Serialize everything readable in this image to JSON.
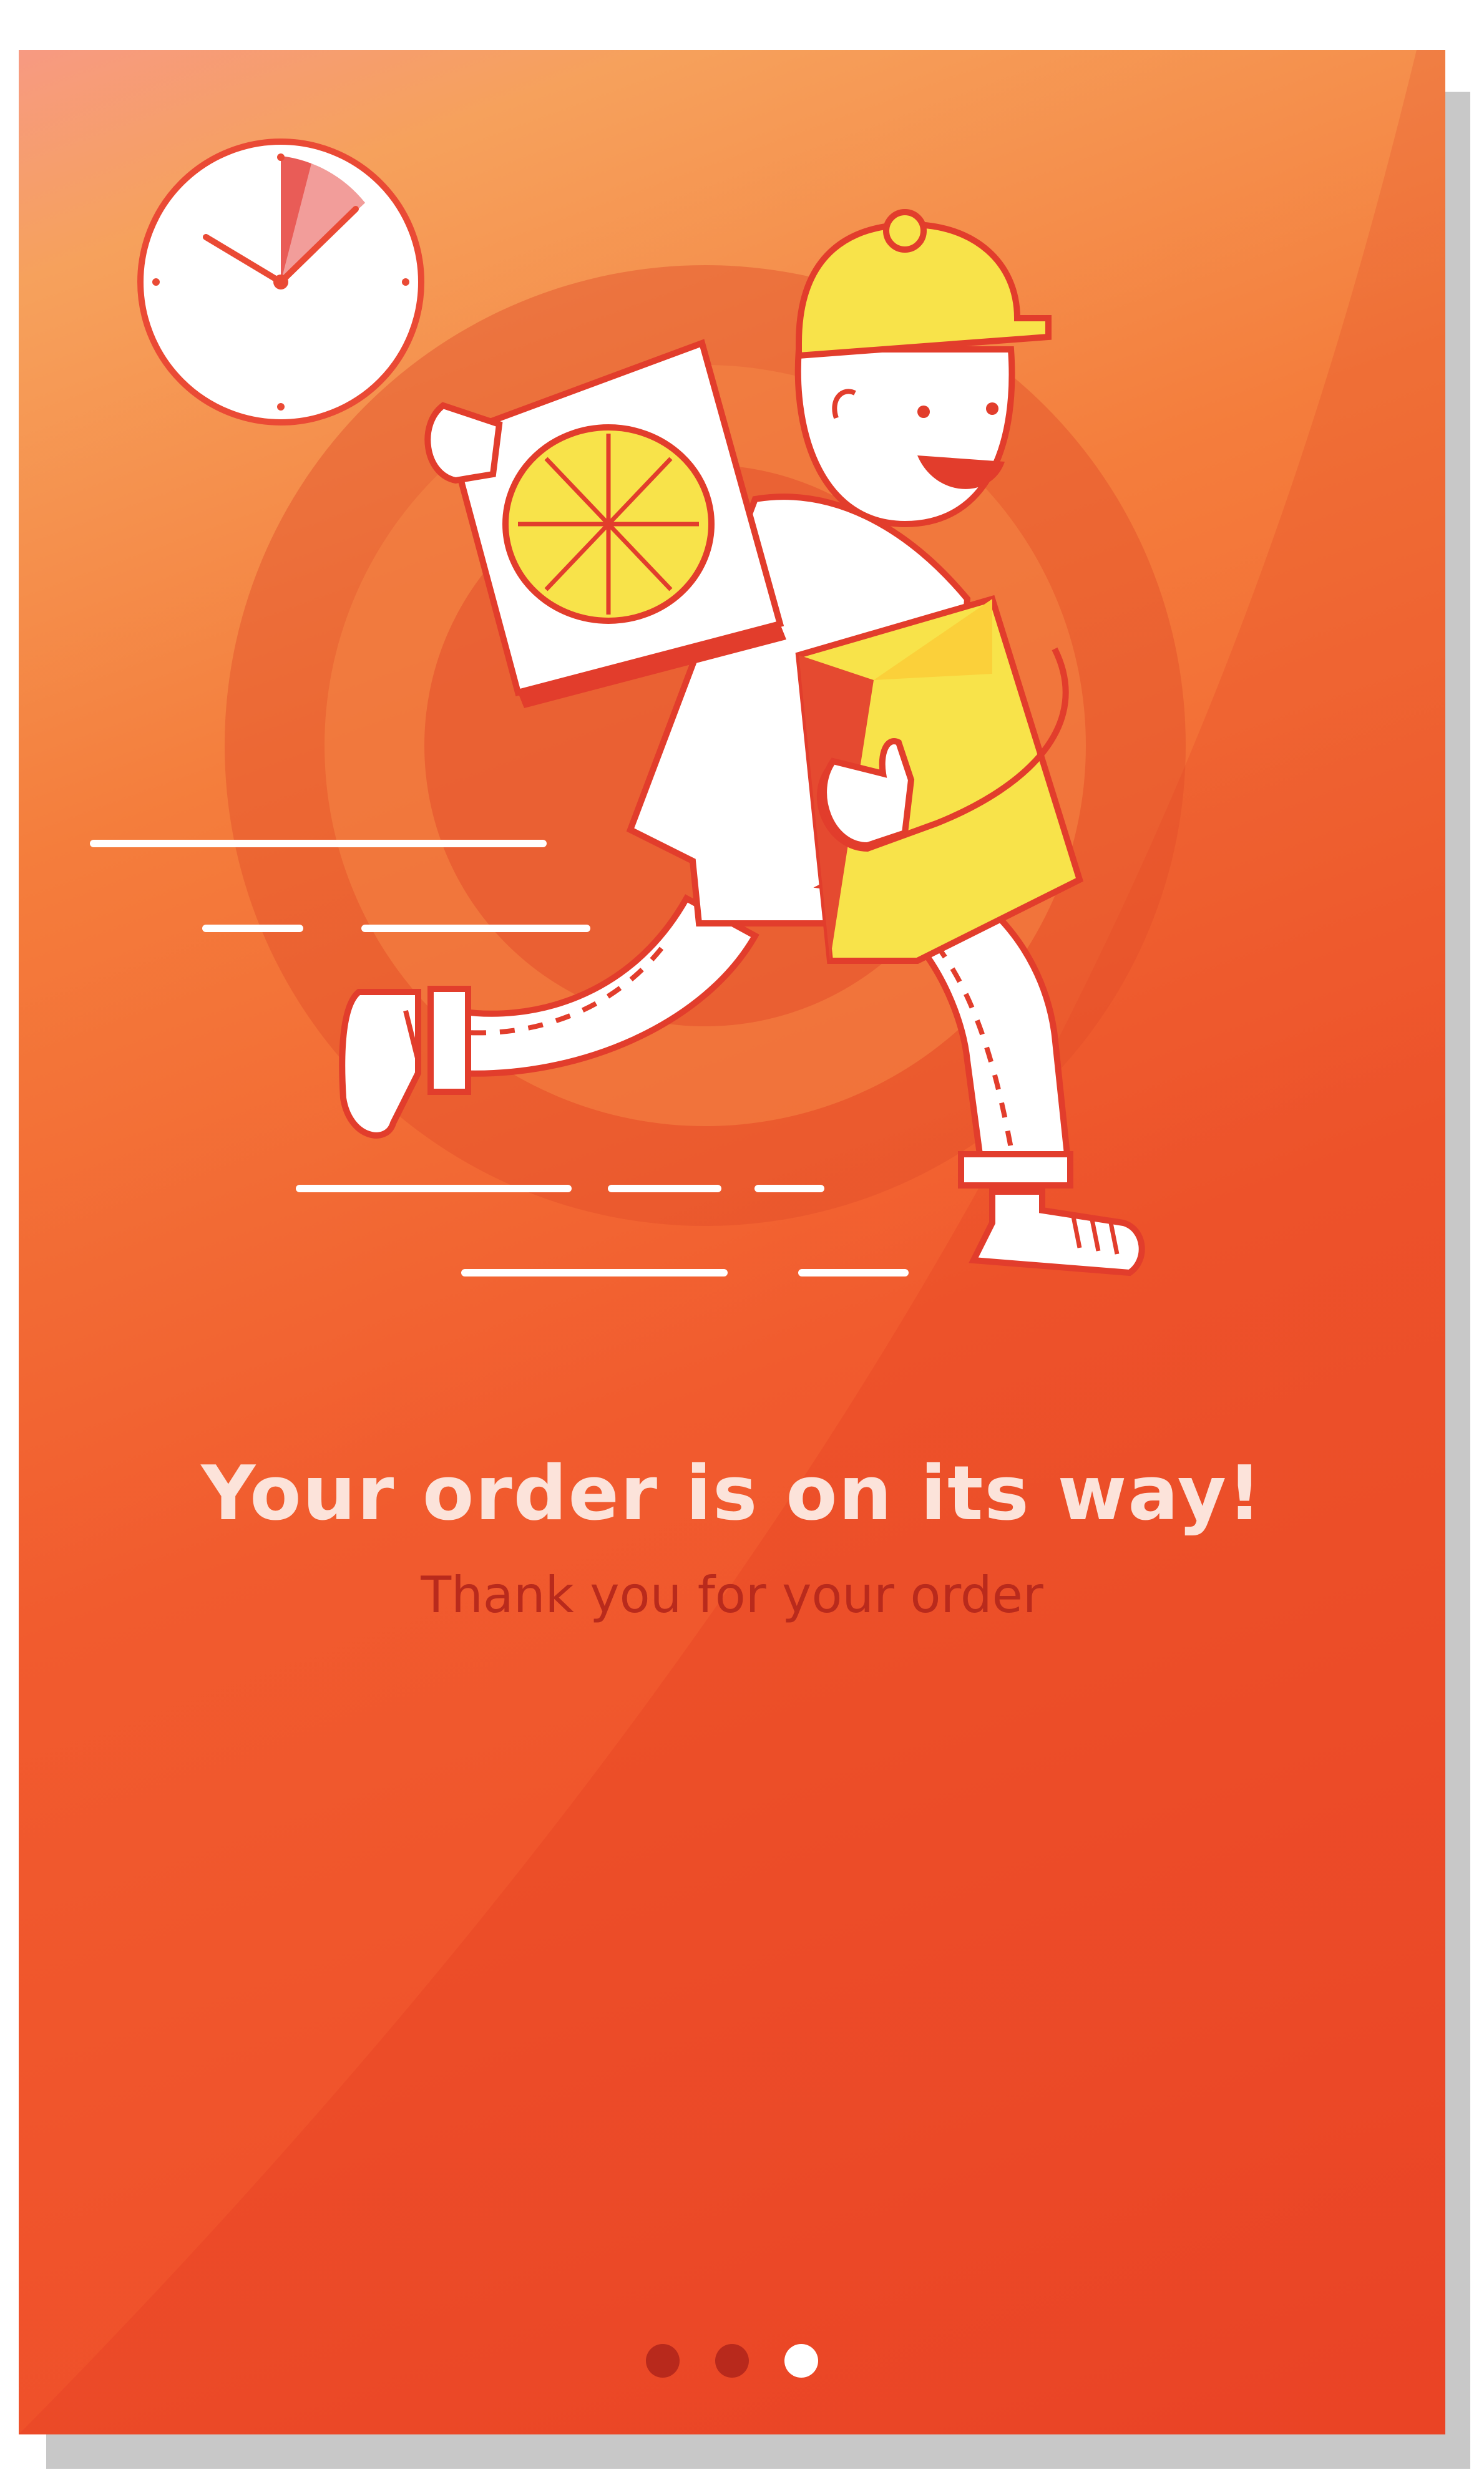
{
  "onboarding": {
    "title": "Your order is on its way!",
    "subtitle": "Thank you for your order",
    "illustration": "delivery-courier-running-with-pizza",
    "pager": {
      "total": 3,
      "active_index": 2
    }
  },
  "colors": {
    "background_top": "#f6a15c",
    "background_bottom": "#ee4a28",
    "title": "#fce3da",
    "subtitle": "#b92a1c",
    "dot_inactive": "#b8291c",
    "dot_active": "#ffffff",
    "outline": "#e23d2c",
    "cap_yellow": "#f8e34a"
  }
}
